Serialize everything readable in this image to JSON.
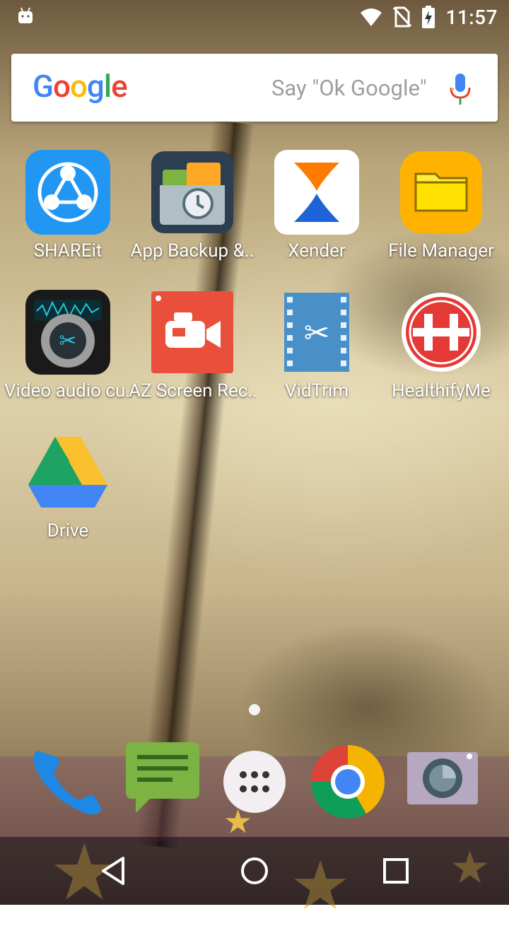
{
  "status_bar": {
    "time": "11:57",
    "icons": [
      "android-debug-icon",
      "wifi-icon",
      "no-sim-icon",
      "battery-charging-icon"
    ]
  },
  "search": {
    "logo": "Google",
    "hint": "Say \"Ok Google\"",
    "mic_icon": "mic-icon"
  },
  "apps": [
    {
      "label": "SHAREit",
      "icon": "shareit-icon"
    },
    {
      "label": "App Backup &..",
      "icon": "app-backup-icon"
    },
    {
      "label": "Xender",
      "icon": "xender-icon"
    },
    {
      "label": "File Manager",
      "icon": "file-manager-icon"
    },
    {
      "label": "Video audio cu..",
      "icon": "video-audio-cutter-icon"
    },
    {
      "label": "AZ Screen Rec..",
      "icon": "az-screen-recorder-icon"
    },
    {
      "label": "VidTrim",
      "icon": "vidtrim-icon"
    },
    {
      "label": "HealthifyMe",
      "icon": "healthifyme-icon"
    },
    {
      "label": "Drive",
      "icon": "drive-icon"
    }
  ],
  "dock": [
    "phone-icon",
    "messaging-icon",
    "app-drawer-icon",
    "chrome-icon",
    "camera-icon"
  ],
  "nav": [
    "back-icon",
    "home-icon",
    "recents-icon"
  ],
  "colors": {
    "shareit": "#2196f3",
    "file_manager": "#ffb300",
    "az_recorder": "#ea4f3c",
    "healthify": "#e53935",
    "vidtrim": "#4a90c8"
  }
}
